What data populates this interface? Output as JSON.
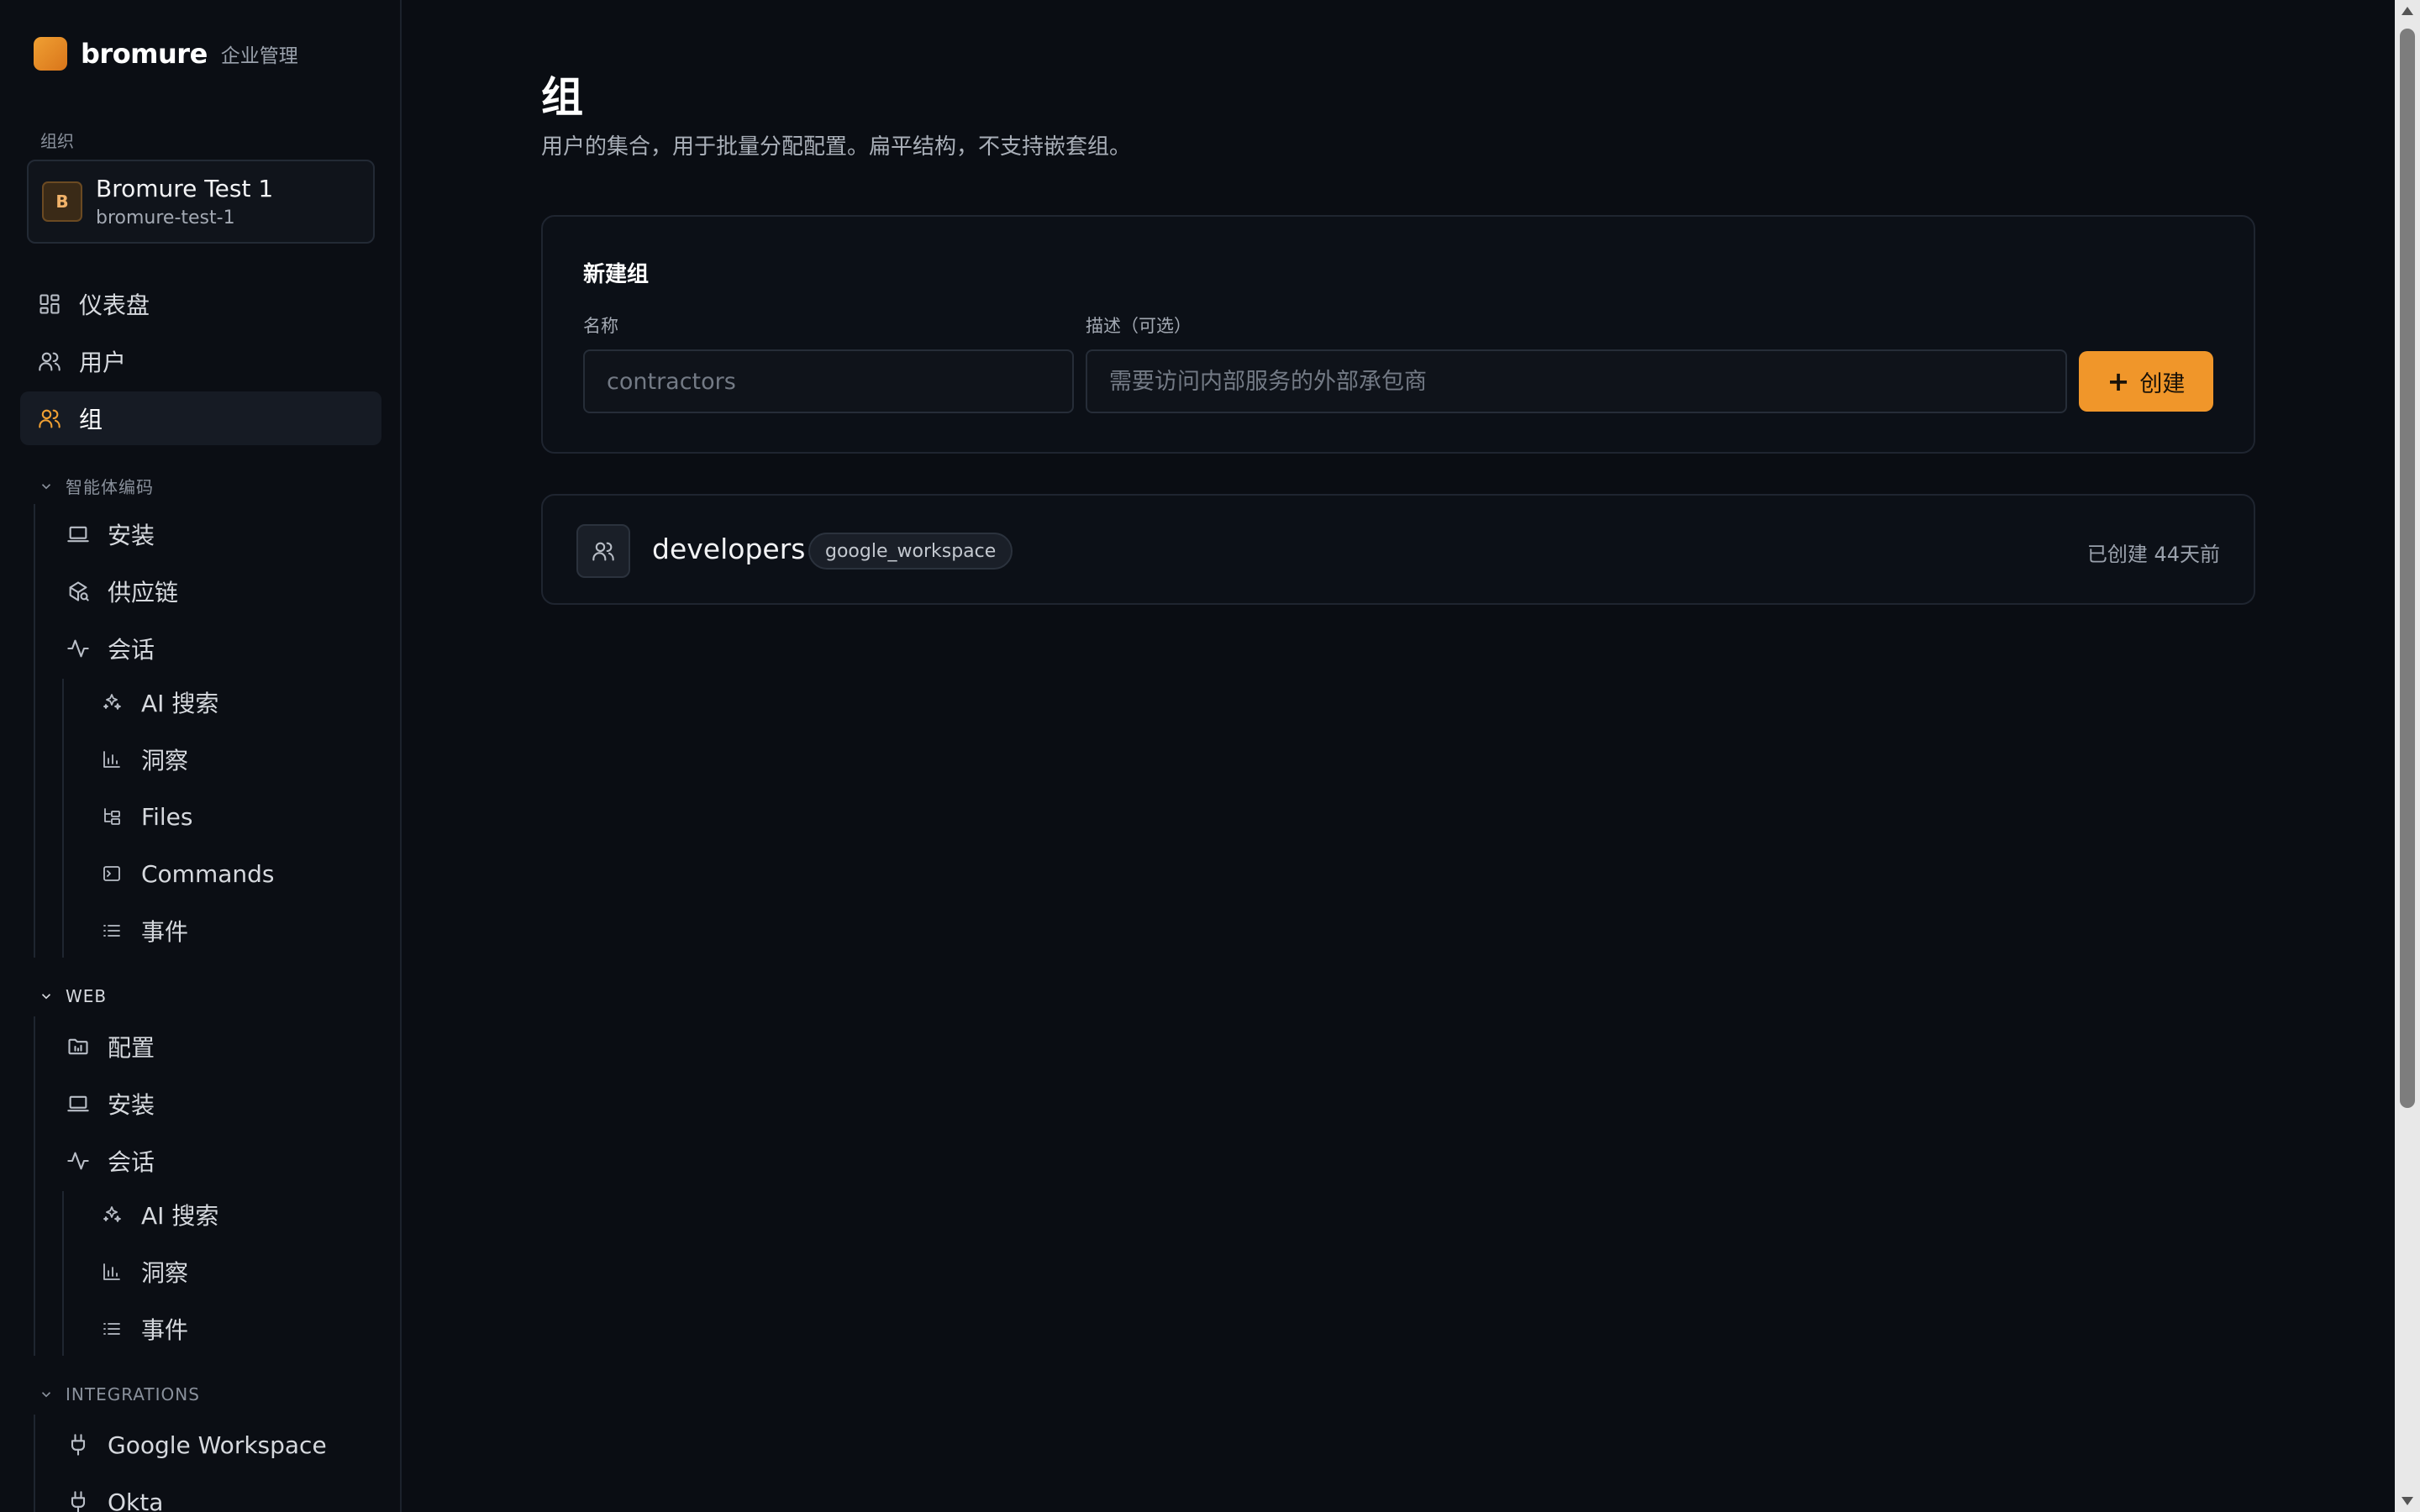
{
  "brand": {
    "name": "bromure",
    "subtitle": "企业管理",
    "accent": "#f0a033"
  },
  "org": {
    "label": "组织",
    "avatar": "B",
    "name": "Bromure Test 1",
    "slug": "bromure-test-1"
  },
  "nav": {
    "dashboard": "仪表盘",
    "users": "用户",
    "groups": "组",
    "agent_section": "智能体编码",
    "agent_install": "安装",
    "agent_supply_chain": "供应链",
    "agent_sessions": "会话",
    "agent_ai_search": "AI 搜索",
    "agent_insights": "洞察",
    "agent_files": "Files",
    "agent_commands": "Commands",
    "agent_events": "事件",
    "web_section": "WEB",
    "web_config": "配置",
    "web_install": "安装",
    "web_sessions": "会话",
    "web_ai_search": "AI 搜索",
    "web_insights": "洞察",
    "web_events": "事件",
    "integrations_section": "INTEGRATIONS",
    "google_workspace": "Google Workspace",
    "okta": "Okta"
  },
  "page": {
    "title": "组",
    "subtitle": "用户的集合，用于批量分配配置。扁平结构，不支持嵌套组。"
  },
  "new_group": {
    "title": "新建组",
    "name_label": "名称",
    "name_placeholder": "contractors",
    "desc_label": "描述（可选）",
    "desc_placeholder": "需要访问内部服务的外部承包商",
    "create_plus": "+",
    "create_label": "创建"
  },
  "groups": [
    {
      "name": "developers",
      "source": "google_workspace",
      "created": "已创建 44天前"
    }
  ]
}
